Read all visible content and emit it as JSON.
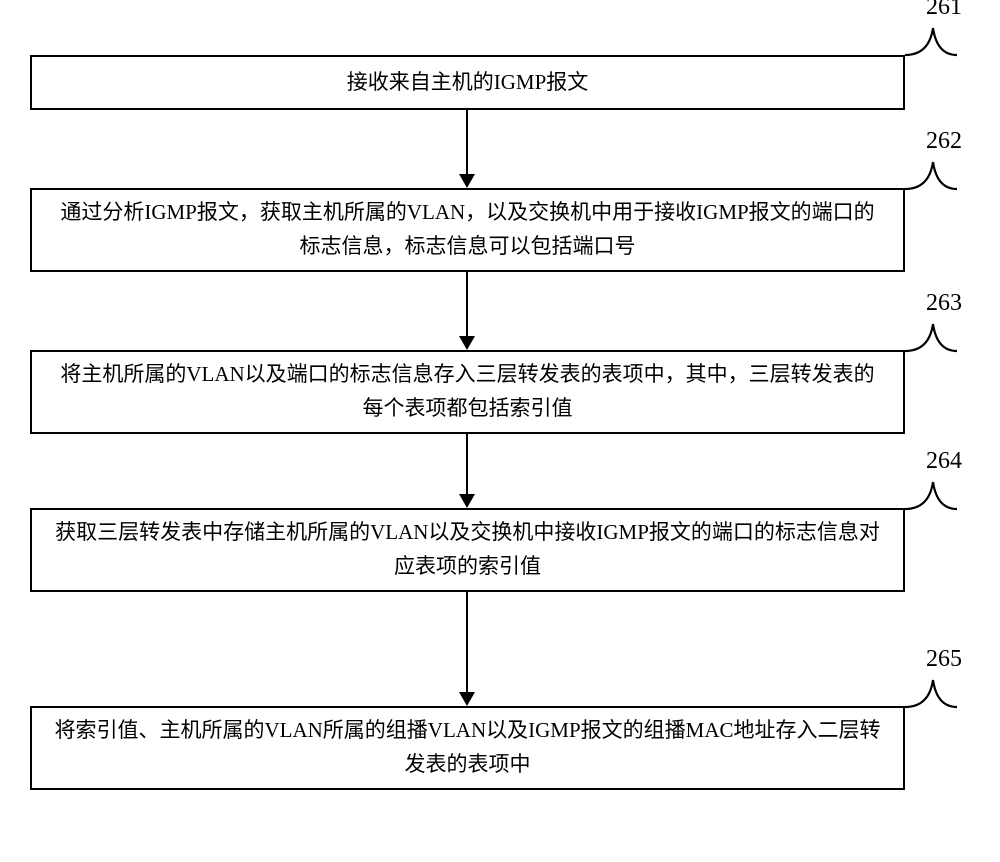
{
  "diagram": {
    "steps": [
      {
        "id": "261",
        "text": "接收来自主机的IGMP报文"
      },
      {
        "id": "262",
        "text": "通过分析IGMP报文，获取主机所属的VLAN，以及交换机中用于接收IGMP报文的端口的标志信息，标志信息可以包括端口号"
      },
      {
        "id": "263",
        "text": "将主机所属的VLAN以及端口的标志信息存入三层转发表的表项中，其中，三层转发表的每个表项都包括索引值"
      },
      {
        "id": "264",
        "text": "获取三层转发表中存储主机所属的VLAN以及交换机中接收IGMP报文的端口的标志信息对应表项的索引值"
      },
      {
        "id": "265",
        "text": "将索引值、主机所属的VLAN所属的组播VLAN以及IGMP报文的组播MAC地址存入二层转发表的表项中"
      }
    ]
  }
}
